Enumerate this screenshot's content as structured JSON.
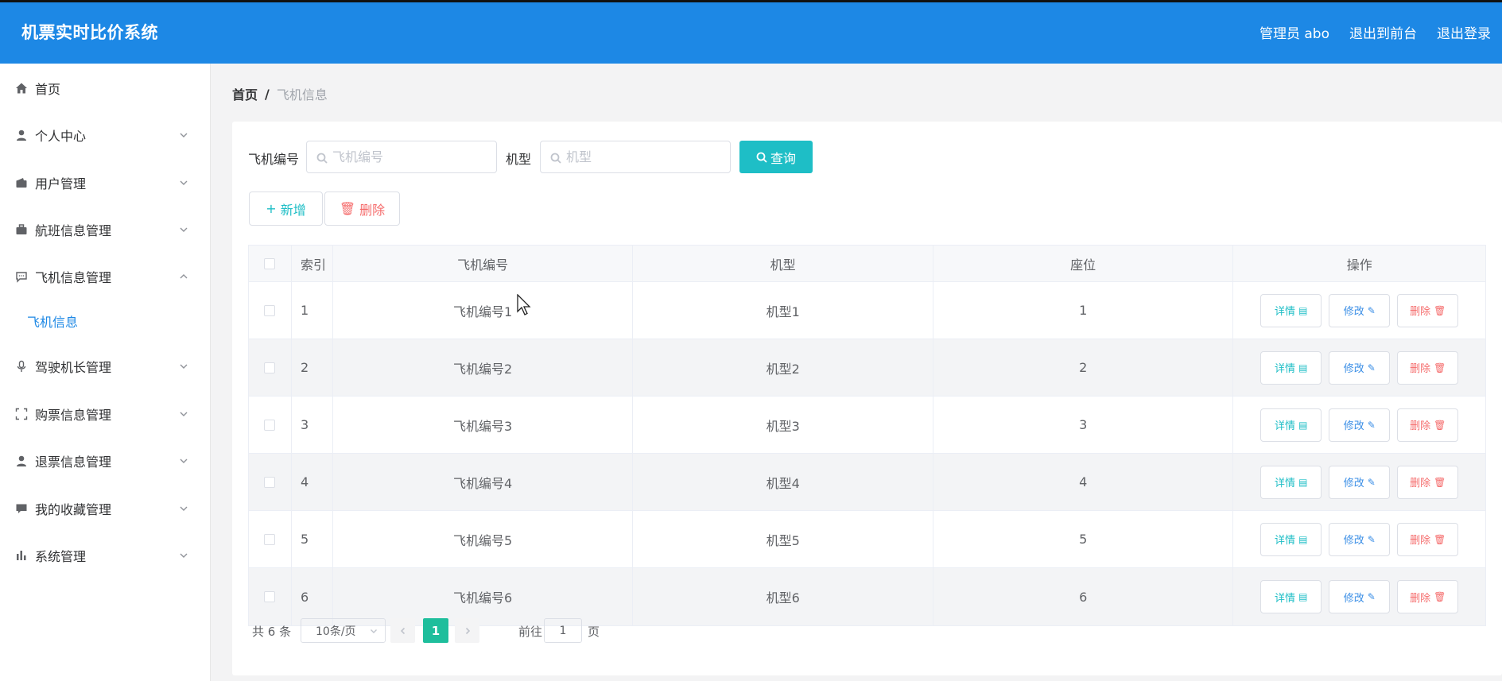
{
  "header": {
    "title": "机票实时比价系统",
    "user": "管理员 abo",
    "to_front": "退出到前台",
    "logout": "退出登录"
  },
  "sidebar": {
    "items": [
      {
        "label": "首页",
        "icon": "home-icon"
      },
      {
        "label": "个人中心",
        "icon": "user-icon"
      },
      {
        "label": "用户管理",
        "icon": "wallet-icon"
      },
      {
        "label": "航班信息管理",
        "icon": "suitcase-icon"
      },
      {
        "label": "飞机信息管理",
        "icon": "chat-icon"
      },
      {
        "label": "驾驶机长管理",
        "icon": "microphone-icon"
      },
      {
        "label": "购票信息管理",
        "icon": "fullscreen-icon"
      },
      {
        "label": "退票信息管理",
        "icon": "user-icon"
      },
      {
        "label": "我的收藏管理",
        "icon": "message-icon"
      },
      {
        "label": "系统管理",
        "icon": "chart-icon"
      }
    ],
    "sub_item": "飞机信息"
  },
  "breadcrumb": {
    "home": "首页",
    "sep": "/",
    "current": "飞机信息"
  },
  "search": {
    "no_label": "飞机编号",
    "no_placeholder": "飞机编号",
    "type_label": "机型",
    "type_placeholder": "机型",
    "query": "查询"
  },
  "toolbar": {
    "add": "新增",
    "delete": "删除"
  },
  "table": {
    "headers": {
      "index": "索引",
      "no": "飞机编号",
      "type": "机型",
      "seat": "座位",
      "ops": "操作"
    },
    "rows": [
      {
        "index": "1",
        "no": "飞机编号1",
        "type": "机型1",
        "seat": "1"
      },
      {
        "index": "2",
        "no": "飞机编号2",
        "type": "机型2",
        "seat": "2"
      },
      {
        "index": "3",
        "no": "飞机编号3",
        "type": "机型3",
        "seat": "3"
      },
      {
        "index": "4",
        "no": "飞机编号4",
        "type": "机型4",
        "seat": "4"
      },
      {
        "index": "5",
        "no": "飞机编号5",
        "type": "机型5",
        "seat": "5"
      },
      {
        "index": "6",
        "no": "飞机编号6",
        "type": "机型6",
        "seat": "6"
      }
    ],
    "ops": {
      "detail": "详情",
      "edit": "修改",
      "remove": "删除"
    }
  },
  "pagination": {
    "total": "共 6 条",
    "page_size": "10条/页",
    "current_page": "1",
    "goto_label": "前往",
    "goto_value": "1",
    "page_unit": "页"
  },
  "colors": {
    "header": "#1d88e5",
    "accent": "#1ebec6",
    "danger": "#f56c6c",
    "page_active": "#1ebe9c"
  }
}
